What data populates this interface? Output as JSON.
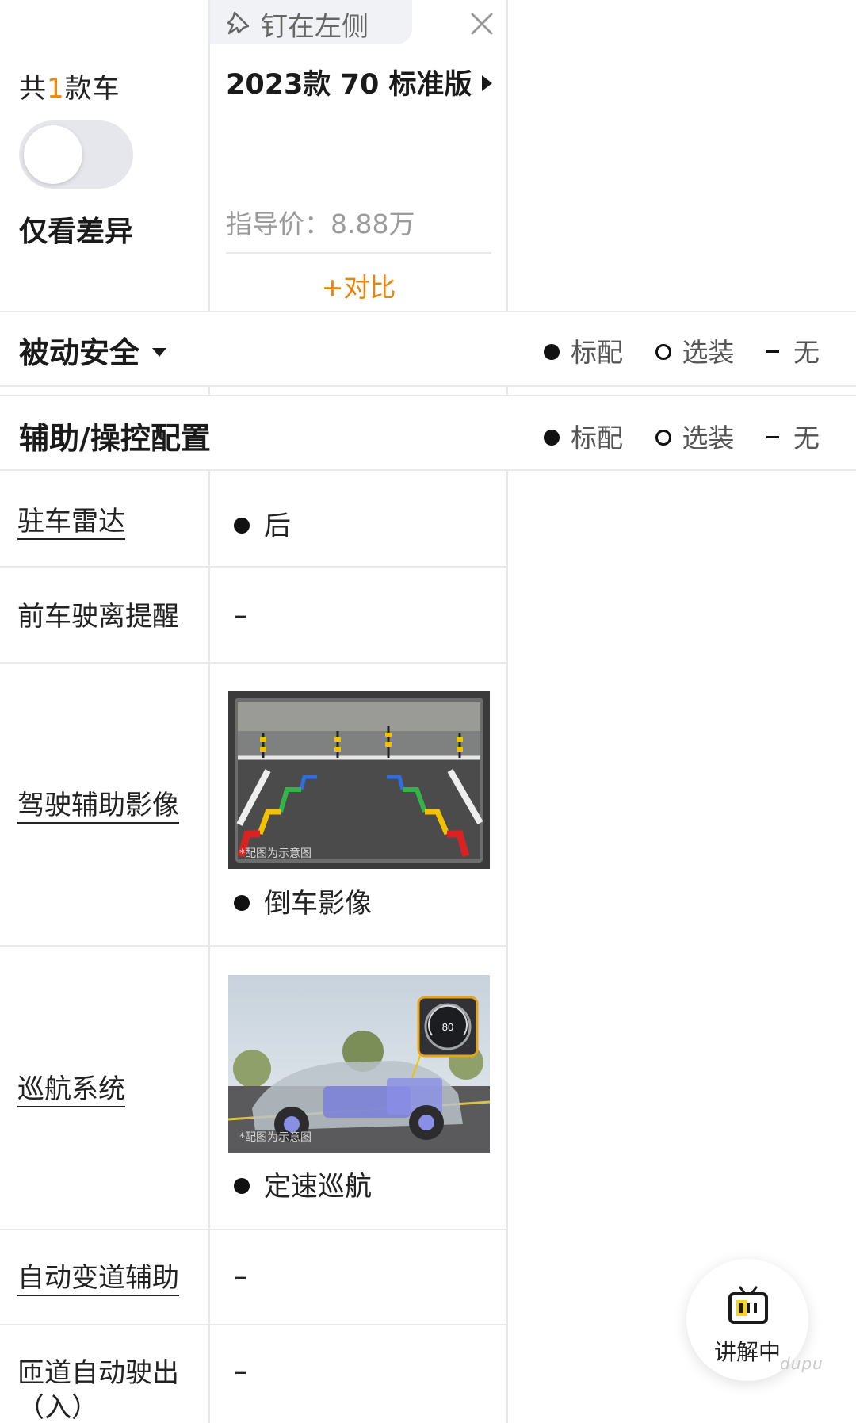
{
  "header": {
    "car_count_prefix": "共",
    "car_count_num": "1",
    "car_count_suffix": "款车",
    "diff_toggle_label": "仅看差异",
    "pin_label": "钉在左侧",
    "car_name": "2023款 70 标准版",
    "price": "指导价：8.88万",
    "compare_label": "+对比"
  },
  "legend": {
    "standard": "标配",
    "optional": "选装",
    "none": "无"
  },
  "sections": [
    {
      "title": "被动安全"
    },
    {
      "title": "辅助/操控配置"
    }
  ],
  "rows": [
    {
      "label": "驻车雷达",
      "value": "后"
    },
    {
      "label": "前车驶离提醒",
      "value": "–"
    },
    {
      "label": "驾驶辅助影像",
      "value": "倒车影像",
      "image_note": "*配图为示意图"
    },
    {
      "label": "巡航系统",
      "value": "定速巡航",
      "image_note": "*配图为示意图",
      "speed": "80"
    },
    {
      "label": "自动变道辅助",
      "value": "–"
    },
    {
      "label": "匝道自动驶出（入）",
      "label_line1": "匝道自动驶出",
      "label_line2": "（入）",
      "value": "–"
    }
  ],
  "floating_button": {
    "label": "讲解中"
  },
  "watermark": "dupu",
  "colors": {
    "accent": "#f0890f",
    "compare": "#e5850e",
    "divider": "#e9e9e9",
    "toggle_bg": "#e6e7ec"
  }
}
